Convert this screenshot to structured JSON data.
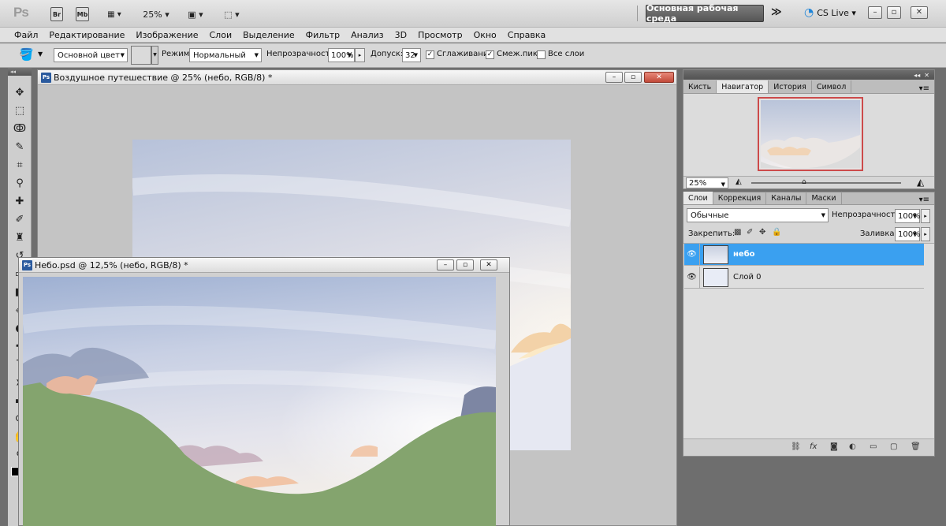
{
  "appbar": {
    "logo": "Ps",
    "bridge": "Br",
    "minibridge": "Mb",
    "zoom": "25%",
    "workspace": "Основная рабочая среда",
    "cs_live": "CS Live"
  },
  "menu": [
    "Файл",
    "Редактирование",
    "Изображение",
    "Слои",
    "Выделение",
    "Фильтр",
    "Анализ",
    "3D",
    "Просмотр",
    "Окно",
    "Справка"
  ],
  "options": {
    "fill_source": "Основной цвет",
    "mode_label": "Режим:",
    "mode_value": "Нормальный",
    "opacity_label": "Непрозрачность:",
    "opacity_value": "100%",
    "tolerance_label": "Допуск:",
    "tolerance_value": "32",
    "antialias_label": "Сглаживание",
    "contiguous_label": "Смеж.пикс",
    "all_layers_label": "Все слои"
  },
  "doc1": {
    "title": "Воздушное путешествие @ 25% (небо, RGB/8) *"
  },
  "doc2": {
    "title": "Небо.psd @ 12,5% (небо, RGB/8) *"
  },
  "navigator": {
    "tabs": [
      "Кисть",
      "Навигатор",
      "История",
      "Символ"
    ],
    "zoom": "25%"
  },
  "layers": {
    "tabs": [
      "Слои",
      "Коррекция",
      "Каналы",
      "Маски"
    ],
    "blend_mode": "Обычные",
    "opacity_label": "Непрозрачность:",
    "opacity_value": "100%",
    "lock_label": "Закрепить:",
    "fill_label": "Заливка:",
    "fill_value": "100%",
    "items": [
      {
        "name": "небо",
        "selected": true
      },
      {
        "name": "Слой 0",
        "selected": false
      }
    ]
  },
  "colors": {
    "selection": "#3aa0f0",
    "ground": "#84a46e",
    "accent_red": "#cc4a4a"
  }
}
